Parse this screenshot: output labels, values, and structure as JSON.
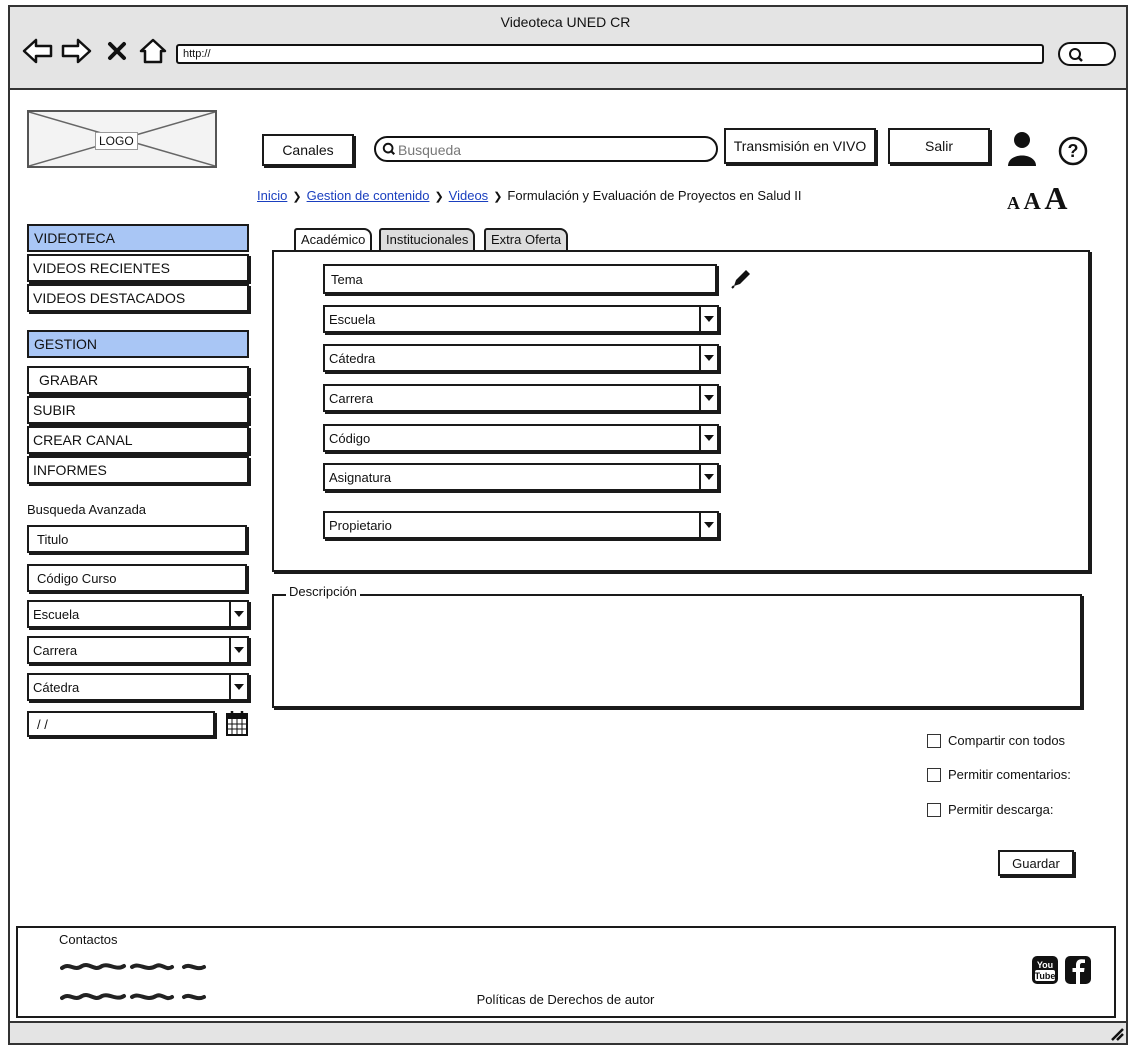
{
  "browser": {
    "window_title": "Videoteca UNED CR",
    "url": "http://"
  },
  "header": {
    "logo_label": "LOGO",
    "canales_label": "Canales",
    "search_placeholder": "Busqueda",
    "live_label": "Transmisión en VIVO",
    "salir_label": "Salir"
  },
  "breadcrumb": {
    "items": [
      "Inicio",
      "Gestion de contenido",
      "Videos"
    ],
    "current": "Formulación y Evaluación de Proyectos en Salud II"
  },
  "font_sizes": {
    "small": "A",
    "medium": "A",
    "large": "A"
  },
  "sidebar": {
    "videoteca_header": "VIDEOTECA",
    "videoteca_items": [
      "VIDEOS RECIENTES",
      "VIDEOS DESTACADOS"
    ],
    "gestion_header": "GESTION",
    "gestion_items": [
      "GRABAR",
      "SUBIR",
      "CREAR CANAL",
      "INFORMES"
    ]
  },
  "advanced_search": {
    "title": "Busqueda Avanzada",
    "titulo": "Titulo",
    "codigo_curso": "Código Curso",
    "escuela": "Escuela",
    "carrera": "Carrera",
    "catedra": "Cátedra",
    "date": " / /"
  },
  "tabs": [
    "Académico",
    "Institucionales",
    "Extra Oferta"
  ],
  "form": {
    "tema": "Tema",
    "escuela": "Escuela",
    "catedra": "Cátedra",
    "carrera": "Carrera",
    "codigo": "Código",
    "asignatura": "Asignatura",
    "propietario": "Propietario"
  },
  "descripcion_label": "Descripción",
  "options": {
    "compartir": "Compartir con todos",
    "comentarios": "Permitir comentarios:",
    "descarga": "Permitir descarga:"
  },
  "guardar_label": "Guardar",
  "footer": {
    "contactos": "Contactos",
    "politicas": "Políticas de Derechos de autor"
  },
  "colors": {
    "sidebar_header_bg": "#a9c6f5",
    "link": "#1a3fbf",
    "chrome": "#e4e4e4"
  },
  "icons": [
    "back-icon",
    "forward-icon",
    "stop-icon",
    "home-icon",
    "search-icon",
    "user-icon",
    "help-icon",
    "pencil-icon",
    "calendar-icon",
    "youtube-icon",
    "facebook-icon"
  ]
}
